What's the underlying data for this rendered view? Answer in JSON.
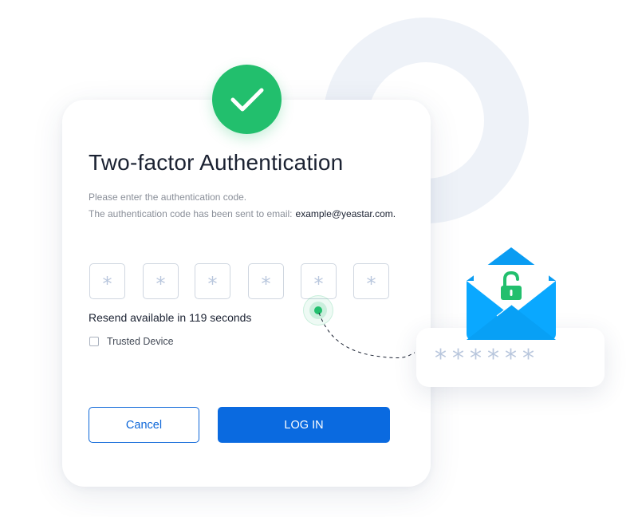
{
  "dialog": {
    "title": "Two-factor Authentication",
    "instruction": "Please enter the authentication code.",
    "sent_message": "The authentication code has been sent to email:",
    "email": "example@yeastar.com.",
    "code_placeholder": "*",
    "code_slots": [
      "*",
      "*",
      "*",
      "*",
      "*",
      "*"
    ],
    "resend_text": "Resend available in 119 seconds",
    "trusted_device_label": "Trusted Device",
    "trusted_device_checked": false,
    "cancel_label": "Cancel",
    "login_label": "LOG IN"
  },
  "illustration": {
    "masked_code": "******",
    "icons": [
      "check-icon",
      "envelope-icon",
      "unlocked-padlock-icon"
    ]
  },
  "colors": {
    "primary": "#0a6ae0",
    "success": "#22bf6d",
    "envelope": "#0aa8ff",
    "mask": "#b9c7dd",
    "ring": "#eef2f8"
  }
}
